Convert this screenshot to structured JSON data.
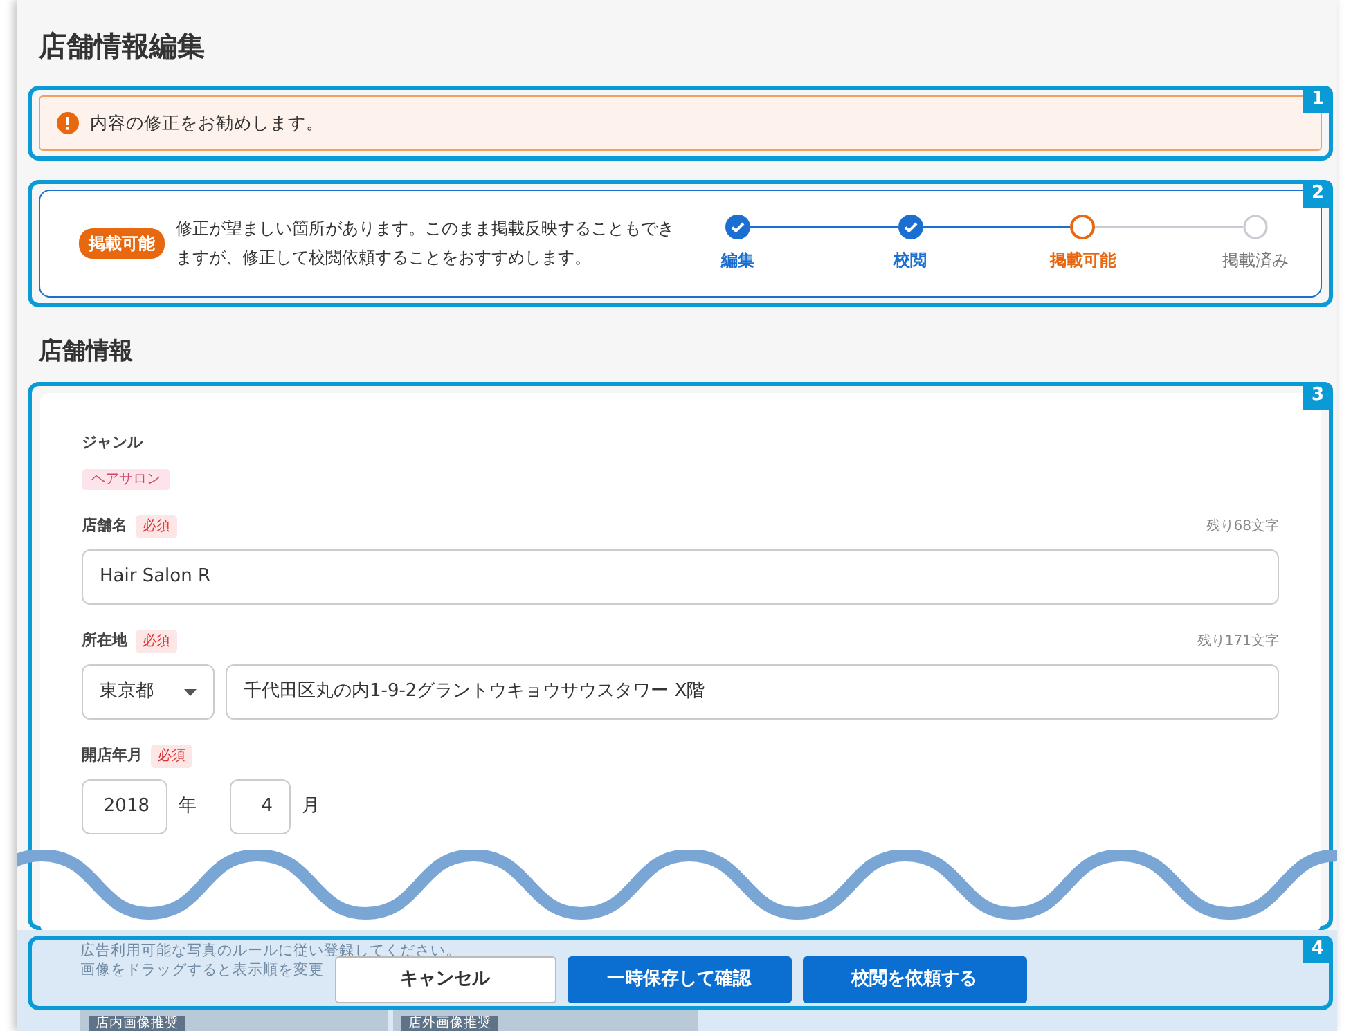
{
  "page_title": "店舗情報編集",
  "alert": {
    "callout": "1",
    "message": "内容の修正をお勧めします。"
  },
  "status": {
    "callout": "2",
    "badge": "掲載可能",
    "message": "修正が望ましい箇所があります。このまま掲載反映することもできますが、修正して校閲依頼することをおすすめします。",
    "steps": [
      {
        "label": "編集",
        "completed": true,
        "current": false
      },
      {
        "label": "校閲",
        "completed": true,
        "current": false
      },
      {
        "label": "掲載可能",
        "completed": false,
        "current": true
      },
      {
        "label": "掲載済み",
        "completed": false,
        "current": false
      }
    ]
  },
  "section_title": "店舗情報",
  "form": {
    "callout": "3",
    "genre": {
      "label": "ジャンル",
      "tag": "ヘアサロン"
    },
    "name": {
      "label": "店舗名",
      "required": "必須",
      "counter": "残り68文字",
      "value": "Hair Salon R"
    },
    "address": {
      "label": "所在地",
      "required": "必須",
      "counter": "残り171文字",
      "prefecture": "東京都",
      "value": "千代田区丸の内1-9-2グラントウキョウサウスタワー X階"
    },
    "opened": {
      "label": "開店年月",
      "required": "必須",
      "year": "2018",
      "year_unit": "年",
      "month": "4",
      "month_unit": "月"
    }
  },
  "photos": {
    "notes": [
      "広告利用可能な写真のルールに従い登録してください。",
      "画像をドラッグすると表示順を変更"
    ],
    "tags": [
      "店内画像推奨",
      "店外画像推奨"
    ]
  },
  "footer": {
    "callout": "4",
    "buttons": [
      {
        "label": "キャンセル",
        "kind": "secondary"
      },
      {
        "label": "一時保存して確認",
        "kind": "primary"
      },
      {
        "label": "校閲を依頼する",
        "kind": "primary"
      }
    ]
  }
}
